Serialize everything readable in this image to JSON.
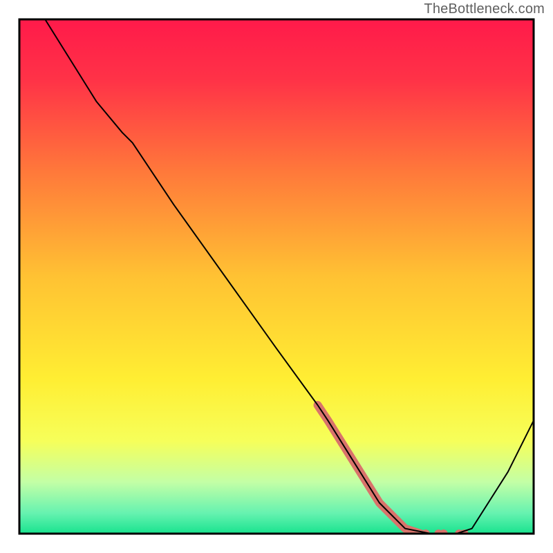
{
  "watermark": "TheBottleneck.com",
  "chart_data": {
    "type": "line",
    "title": "",
    "xlabel": "",
    "ylabel": "",
    "xlim": [
      0,
      100
    ],
    "ylim": [
      0,
      100
    ],
    "grid": false,
    "legend": false,
    "gradient_stops": [
      {
        "offset": 0.0,
        "color": "#ff1a4a"
      },
      {
        "offset": 0.12,
        "color": "#ff3347"
      },
      {
        "offset": 0.3,
        "color": "#ff7a3a"
      },
      {
        "offset": 0.5,
        "color": "#ffc233"
      },
      {
        "offset": 0.7,
        "color": "#ffee33"
      },
      {
        "offset": 0.82,
        "color": "#f6ff5a"
      },
      {
        "offset": 0.9,
        "color": "#c3ffa6"
      },
      {
        "offset": 0.96,
        "color": "#66f2b0"
      },
      {
        "offset": 1.0,
        "color": "#19e38f"
      }
    ],
    "series": [
      {
        "name": "bottleneck-curve",
        "color": "#000000",
        "x": [
          5,
          10,
          15,
          20,
          22,
          30,
          40,
          50,
          58,
          60,
          65,
          70,
          75,
          80,
          85,
          88,
          95,
          100
        ],
        "y": [
          100,
          92,
          84,
          78,
          76,
          64,
          50,
          36,
          25,
          22,
          14,
          6,
          1,
          0,
          0,
          1,
          12,
          22
        ]
      }
    ],
    "highlight_segment": {
      "name": "highlight-band",
      "color": "#d9736b",
      "width": 12,
      "x": [
        58,
        60,
        65,
        70,
        75,
        78
      ],
      "y": [
        25,
        22,
        14,
        6,
        1,
        0
      ]
    },
    "highlight_dots": {
      "name": "highlight-dots",
      "color": "#d9736b",
      "radius": 6,
      "points": [
        {
          "x": 79.0,
          "y": 0
        },
        {
          "x": 81.5,
          "y": 0
        },
        {
          "x": 82.5,
          "y": 0
        },
        {
          "x": 85.5,
          "y": 0
        },
        {
          "x": 86.5,
          "y": 0
        }
      ]
    }
  }
}
